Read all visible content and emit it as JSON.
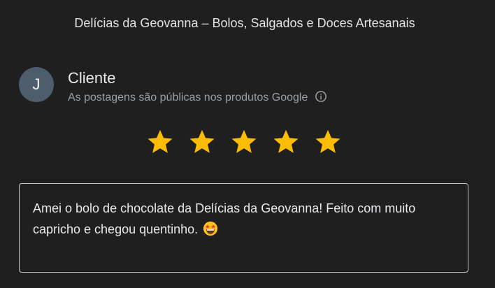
{
  "header": {
    "title": "Delícias da Geovanna – Bolos, Salgados e Doces Artesanais"
  },
  "user": {
    "avatar_letter": "J",
    "name": "Cliente",
    "note": "As postagens são públicas nos produtos Google",
    "avatar_color": "#4d5d6b"
  },
  "rating": {
    "value": 5,
    "max": 5,
    "star_color": "#fbbc04"
  },
  "review": {
    "text": "Amei o bolo de chocolate da Delícias da Geovanna! Feito com muito capricho e chegou quentinho.",
    "emoji": "star-struck-emoji"
  },
  "icons": {
    "info": "info-icon",
    "star": "star-icon"
  }
}
